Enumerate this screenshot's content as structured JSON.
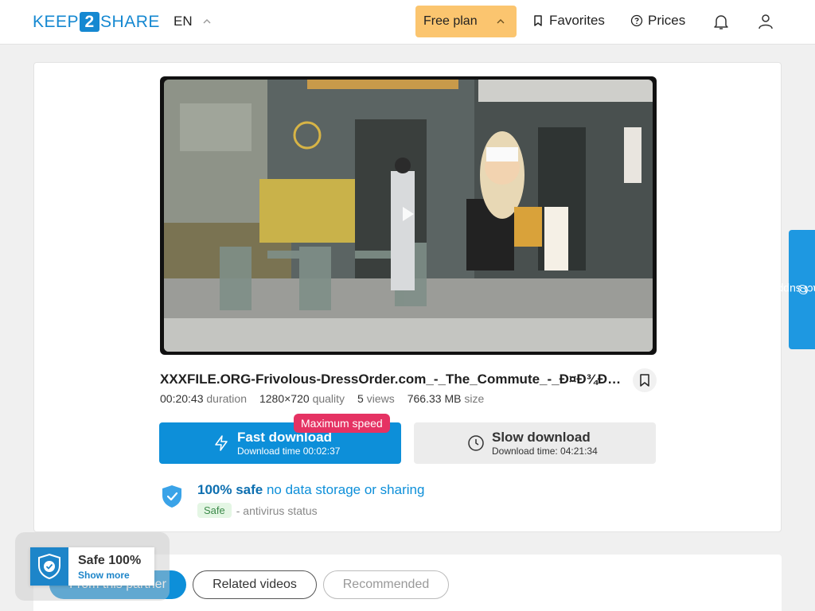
{
  "header": {
    "logo": {
      "left": "KEEP",
      "mid": "2",
      "right": "SHARE"
    },
    "language": "EN",
    "plan_label": "Free plan",
    "favorites_label": "Favorites",
    "prices_label": "Prices"
  },
  "file": {
    "title": "XXXFILE.ORG-Frivolous-DressOrder.com_-_The_Commute_-_Ð¤Ð¾Ð¼Ð¼Ñ...",
    "duration": "00:20:43",
    "duration_label": "duration",
    "quality": "1280×720",
    "quality_label": "quality",
    "views": "5",
    "views_label": "views",
    "size": "766.33 MB",
    "size_label": "size"
  },
  "downloads": {
    "fast_title": "Fast download",
    "fast_time": "Download time 00:02:37",
    "max_badge": "Maximum speed",
    "slow_title": "Slow download",
    "slow_time": "Download time: 04:21:34"
  },
  "safety": {
    "strong": "100% safe",
    "rest": "no data storage or sharing",
    "badge": "Safe",
    "status": "- antivirus status"
  },
  "tabs": [
    {
      "label": "From this partner"
    },
    {
      "label": "Related videos"
    },
    {
      "label": "Recommended"
    }
  ],
  "safe_widget": {
    "title": "Safe 100%",
    "link": "Show more"
  },
  "support_label": "contact support",
  "colors": {
    "accent": "#0d8fd9",
    "plan": "#fbc56f",
    "badge": "#e53263"
  }
}
